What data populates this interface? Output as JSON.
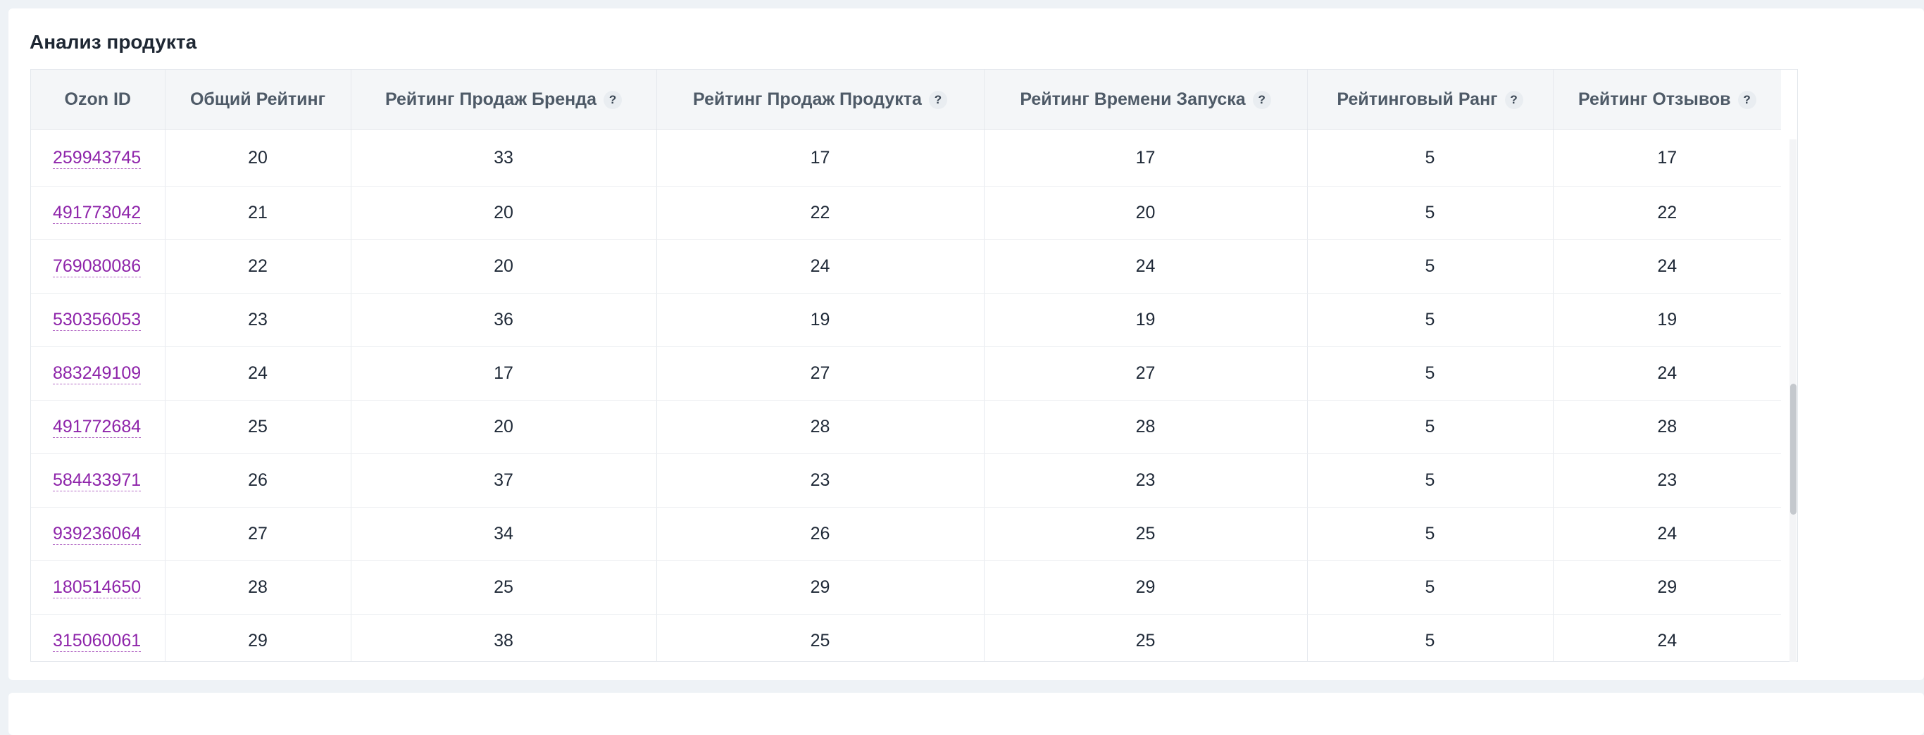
{
  "title": "Анализ продукта",
  "table": {
    "headers": [
      {
        "label": "Ozon ID",
        "help": false
      },
      {
        "label": "Общий Рейтинг",
        "help": false
      },
      {
        "label": "Рейтинг Продаж Бренда",
        "help": true
      },
      {
        "label": "Рейтинг Продаж Продукта",
        "help": true
      },
      {
        "label": "Рейтинг Времени Запуска",
        "help": true
      },
      {
        "label": "Рейтинговый Ранг",
        "help": true
      },
      {
        "label": "Рейтинг Отзывов",
        "help": true
      }
    ],
    "help_glyph": "?",
    "rows": [
      [
        "259943745",
        "20",
        "33",
        "17",
        "17",
        "5",
        "17"
      ],
      [
        "491773042",
        "21",
        "20",
        "22",
        "20",
        "5",
        "22"
      ],
      [
        "769080086",
        "22",
        "20",
        "24",
        "24",
        "5",
        "24"
      ],
      [
        "530356053",
        "23",
        "36",
        "19",
        "19",
        "5",
        "19"
      ],
      [
        "883249109",
        "24",
        "17",
        "27",
        "27",
        "5",
        "24"
      ],
      [
        "491772684",
        "25",
        "20",
        "28",
        "28",
        "5",
        "28"
      ],
      [
        "584433971",
        "26",
        "37",
        "23",
        "23",
        "5",
        "23"
      ],
      [
        "939236064",
        "27",
        "34",
        "26",
        "25",
        "5",
        "24"
      ],
      [
        "180514650",
        "28",
        "25",
        "29",
        "29",
        "5",
        "29"
      ],
      [
        "315060061",
        "29",
        "38",
        "25",
        "25",
        "5",
        "24"
      ]
    ]
  },
  "colors": {
    "link": "#8e24aa",
    "header_bg": "#f4f6f8",
    "page_bg": "#eef2f6"
  },
  "icons": {
    "help": "question-circle-icon"
  }
}
